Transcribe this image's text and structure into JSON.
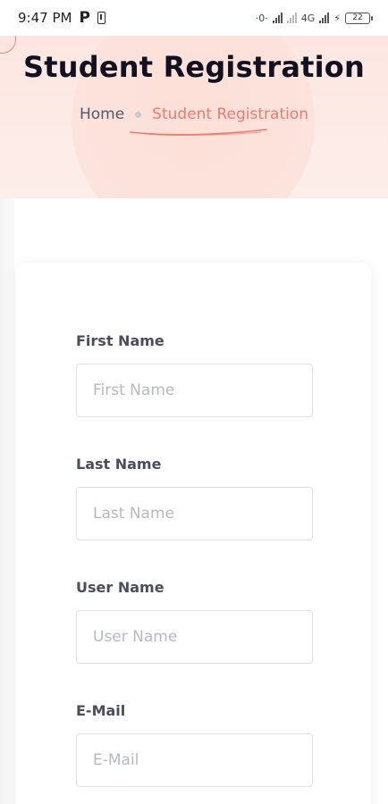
{
  "status_bar": {
    "time": "9:47 PM",
    "app_icon": "P",
    "network_label": "4G",
    "battery": "22"
  },
  "hero": {
    "title": "Student Registration",
    "breadcrumb": {
      "home": "Home",
      "current": "Student Registration"
    },
    "accent_color": "#ee7a70",
    "background_color": "#fde6e1"
  },
  "form": {
    "fields": [
      {
        "label": "First Name",
        "placeholder": "First Name",
        "value": ""
      },
      {
        "label": "Last Name",
        "placeholder": "Last Name",
        "value": ""
      },
      {
        "label": "User Name",
        "placeholder": "User Name",
        "value": ""
      },
      {
        "label": "E-Mail",
        "placeholder": "E-Mail",
        "value": ""
      }
    ]
  }
}
